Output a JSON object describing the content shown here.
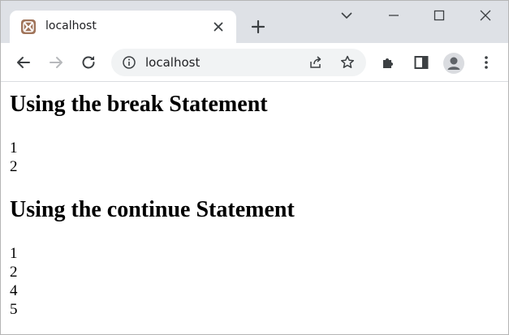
{
  "browser": {
    "tab": {
      "title": "localhost",
      "favicon": "xampp-icon"
    },
    "address_bar": {
      "url": "localhost"
    },
    "icons": {
      "back": "back-arrow-icon",
      "forward": "forward-arrow-icon",
      "reload": "reload-icon",
      "info": "info-icon",
      "share": "share-icon",
      "bookmark": "star-icon",
      "extensions": "puzzle-icon",
      "side_panel": "side-panel-icon",
      "profile": "avatar-icon",
      "menu": "kebab-menu-icon"
    },
    "colors": {
      "tabstrip": "#dee1e6",
      "active_tab": "#ffffff",
      "omnibox": "#f1f3f4",
      "favicon": "#a0745a"
    }
  },
  "page": {
    "sections": [
      {
        "heading": "Using the break Statement",
        "lines": [
          "1",
          "2"
        ]
      },
      {
        "heading": "Using the continue Statement",
        "lines": [
          "1",
          "2",
          "4",
          "5"
        ]
      }
    ]
  }
}
